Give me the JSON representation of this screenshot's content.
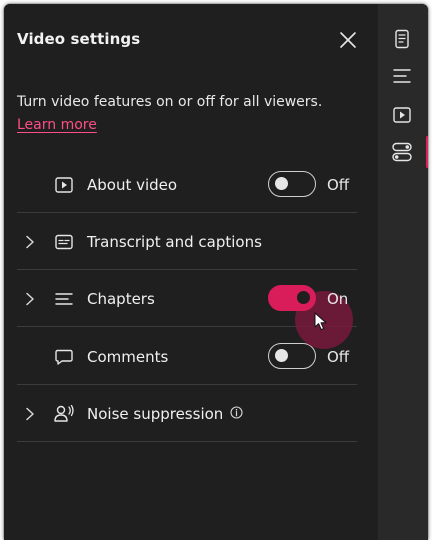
{
  "panel": {
    "title": "Video settings",
    "description": "Turn video features on or off for all viewers.",
    "learn_more": "Learn more"
  },
  "rows": [
    {
      "label": "About video",
      "icon": "play-box-icon",
      "has_chevron": false,
      "toggle": "Off"
    },
    {
      "label": "Transcript and captions",
      "icon": "captions-icon",
      "has_chevron": true,
      "toggle": null
    },
    {
      "label": "Chapters",
      "icon": "chapters-list-icon",
      "has_chevron": true,
      "toggle": "On"
    },
    {
      "label": "Comments",
      "icon": "comment-icon",
      "has_chevron": false,
      "toggle": "Off"
    },
    {
      "label": "Noise suppression",
      "icon": "noise-suppression-icon",
      "has_chevron": true,
      "toggle": null,
      "info_icon": "info-icon"
    }
  ],
  "rail": {
    "items": [
      "document-icon",
      "list-icon",
      "play-box-icon",
      "toggles-icon"
    ],
    "active_item": "toggles-icon"
  },
  "colors": {
    "background": "#1f1f1f",
    "rail_background": "#292929",
    "accent": "#d91c5a",
    "link": "#ff4d86",
    "text": "#f0f0f0",
    "divider": "#3b3b3b"
  }
}
